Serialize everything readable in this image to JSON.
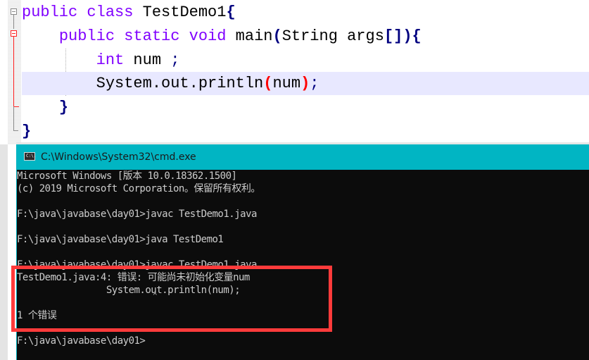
{
  "editor": {
    "lines": [
      {
        "tokens": [
          {
            "t": "public",
            "c": "kw"
          },
          {
            "t": " ",
            "c": "plain"
          },
          {
            "t": "class",
            "c": "kw"
          },
          {
            "t": " TestDemo1",
            "c": "plain"
          },
          {
            "t": "{",
            "c": "brace"
          }
        ]
      },
      {
        "tokens": [
          {
            "t": "    ",
            "c": "plain"
          },
          {
            "t": "public",
            "c": "kw"
          },
          {
            "t": " ",
            "c": "plain"
          },
          {
            "t": "static",
            "c": "kw"
          },
          {
            "t": " ",
            "c": "plain"
          },
          {
            "t": "void",
            "c": "kw"
          },
          {
            "t": " main",
            "c": "plain"
          },
          {
            "t": "(",
            "c": "brace"
          },
          {
            "t": "String args",
            "c": "plain"
          },
          {
            "t": "[])",
            "c": "brace"
          },
          {
            "t": "{",
            "c": "brace"
          }
        ]
      },
      {
        "tokens": [
          {
            "t": "        ",
            "c": "plain"
          },
          {
            "t": "int",
            "c": "kw"
          },
          {
            "t": " num ",
            "c": "plain"
          },
          {
            "t": ";",
            "c": "semi"
          }
        ]
      },
      {
        "tokens": [
          {
            "t": "        System.out.println",
            "c": "plain"
          },
          {
            "t": "(",
            "c": "paren-match"
          },
          {
            "t": "num",
            "c": "plain"
          },
          {
            "t": ")",
            "c": "paren-match"
          },
          {
            "t": ";",
            "c": "semi"
          }
        ],
        "current": true
      },
      {
        "tokens": [
          {
            "t": "    ",
            "c": "plain"
          },
          {
            "t": "}",
            "c": "brace"
          }
        ]
      },
      {
        "tokens": [
          {
            "t": "}",
            "c": "brace"
          }
        ]
      }
    ]
  },
  "cmd": {
    "title": "C:\\Windows\\System32\\cmd.exe",
    "icon_label": "C:\\.",
    "lines": [
      "Microsoft Windows [版本 10.0.18362.1500]",
      "(c) 2019 Microsoft Corporation。保留所有权利。",
      "",
      "F:\\java\\javabase\\day01>javac TestDemo1.java",
      "",
      "F:\\java\\javabase\\day01>java TestDemo1",
      "",
      "F:\\java\\javabase\\day01>javac TestDemo1.java",
      "TestDemo1.java:4: 错误: 可能尚未初始化变量num",
      "                System.out.println(num);",
      "                                   ^",
      "1 个错误",
      "",
      "F:\\java\\javabase\\day01>"
    ]
  },
  "annotation": {
    "highlight_color": "#ff3b3b"
  },
  "colors": {
    "keyword": "#8000ff",
    "brace": "#000080",
    "paren_match": "#ff0000",
    "current_line": "#e8e8ff",
    "cmd_titlebar": "#01b5c3",
    "cmd_background": "#0c0c0c",
    "cmd_text": "#cccccc"
  }
}
